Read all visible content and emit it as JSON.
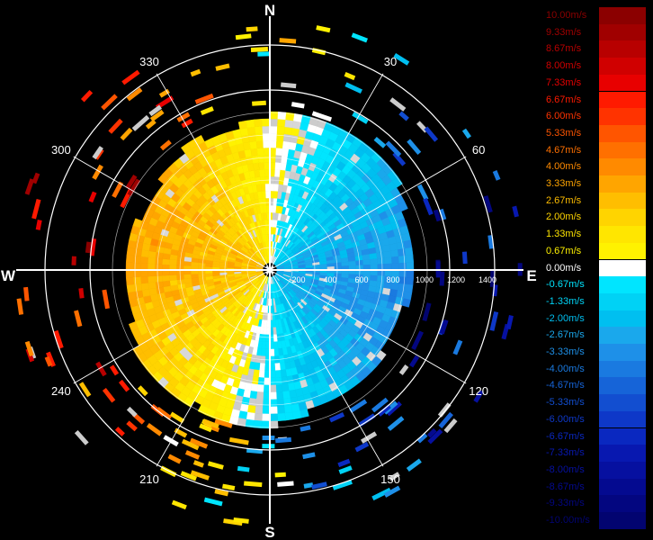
{
  "chart_data": {
    "type": "polar",
    "title": "",
    "compass": {
      "north": "N",
      "south": "S",
      "east": "E",
      "west": "W"
    },
    "bearing_labels": [
      "30",
      "60",
      "120",
      "150",
      "210",
      "240",
      "300",
      "330"
    ],
    "range_labels": [
      "200",
      "400",
      "600",
      "800",
      "1000",
      "1200",
      "1400"
    ],
    "velocity_field": {
      "unit": "m/s",
      "description_pattern": "dipole",
      "outbound_sector_deg": [
        190,
        10
      ],
      "inbound_sector_deg": [
        10,
        190
      ],
      "max_outbound": 3.33,
      "max_inbound": -3.33
    },
    "colorbar": [
      {
        "label": "10.00m/s",
        "color": "#8b0000"
      },
      {
        "label": "9.33m/s",
        "color": "#a00000"
      },
      {
        "label": "8.67m/s",
        "color": "#b80000"
      },
      {
        "label": "8.00m/s",
        "color": "#d00000"
      },
      {
        "label": "7.33m/s",
        "color": "#e80000"
      },
      {
        "label": "6.67m/s",
        "color": "#ff1a00"
      },
      {
        "label": "6.00m/s",
        "color": "#ff3300"
      },
      {
        "label": "5.33m/s",
        "color": "#ff5500"
      },
      {
        "label": "4.67m/s",
        "color": "#ff7000"
      },
      {
        "label": "4.00m/s",
        "color": "#ff8a00"
      },
      {
        "label": "3.33m/s",
        "color": "#ffa500"
      },
      {
        "label": "2.67m/s",
        "color": "#ffbe00"
      },
      {
        "label": "2.00m/s",
        "color": "#ffd400"
      },
      {
        "label": "1.33m/s",
        "color": "#ffe600"
      },
      {
        "label": "0.67m/s",
        "color": "#fff200"
      },
      {
        "label": "0.00m/s",
        "color": "#ffffff"
      },
      {
        "label": "-0.67m/s",
        "color": "#00e5ff"
      },
      {
        "label": "-1.33m/s",
        "color": "#00d2f5"
      },
      {
        "label": "-2.00m/s",
        "color": "#00bff0"
      },
      {
        "label": "-2.67m/s",
        "color": "#1aa8ec"
      },
      {
        "label": "-3.33m/s",
        "color": "#1e90e8"
      },
      {
        "label": "-4.00m/s",
        "color": "#1a7ae0"
      },
      {
        "label": "-4.67m/s",
        "color": "#1664d8"
      },
      {
        "label": "-5.33m/s",
        "color": "#124ed0"
      },
      {
        "label": "-6.00m/s",
        "color": "#0e38c8"
      },
      {
        "label": "-6.67m/s",
        "color": "#0a28c0"
      },
      {
        "label": "-7.33m/s",
        "color": "#0818b0"
      },
      {
        "label": "-8.00m/s",
        "color": "#0610a0"
      },
      {
        "label": "-8.67m/s",
        "color": "#040a90"
      },
      {
        "label": "-9.33m/s",
        "color": "#030680"
      },
      {
        "label": "-10.00m/s",
        "color": "#020470"
      }
    ]
  }
}
